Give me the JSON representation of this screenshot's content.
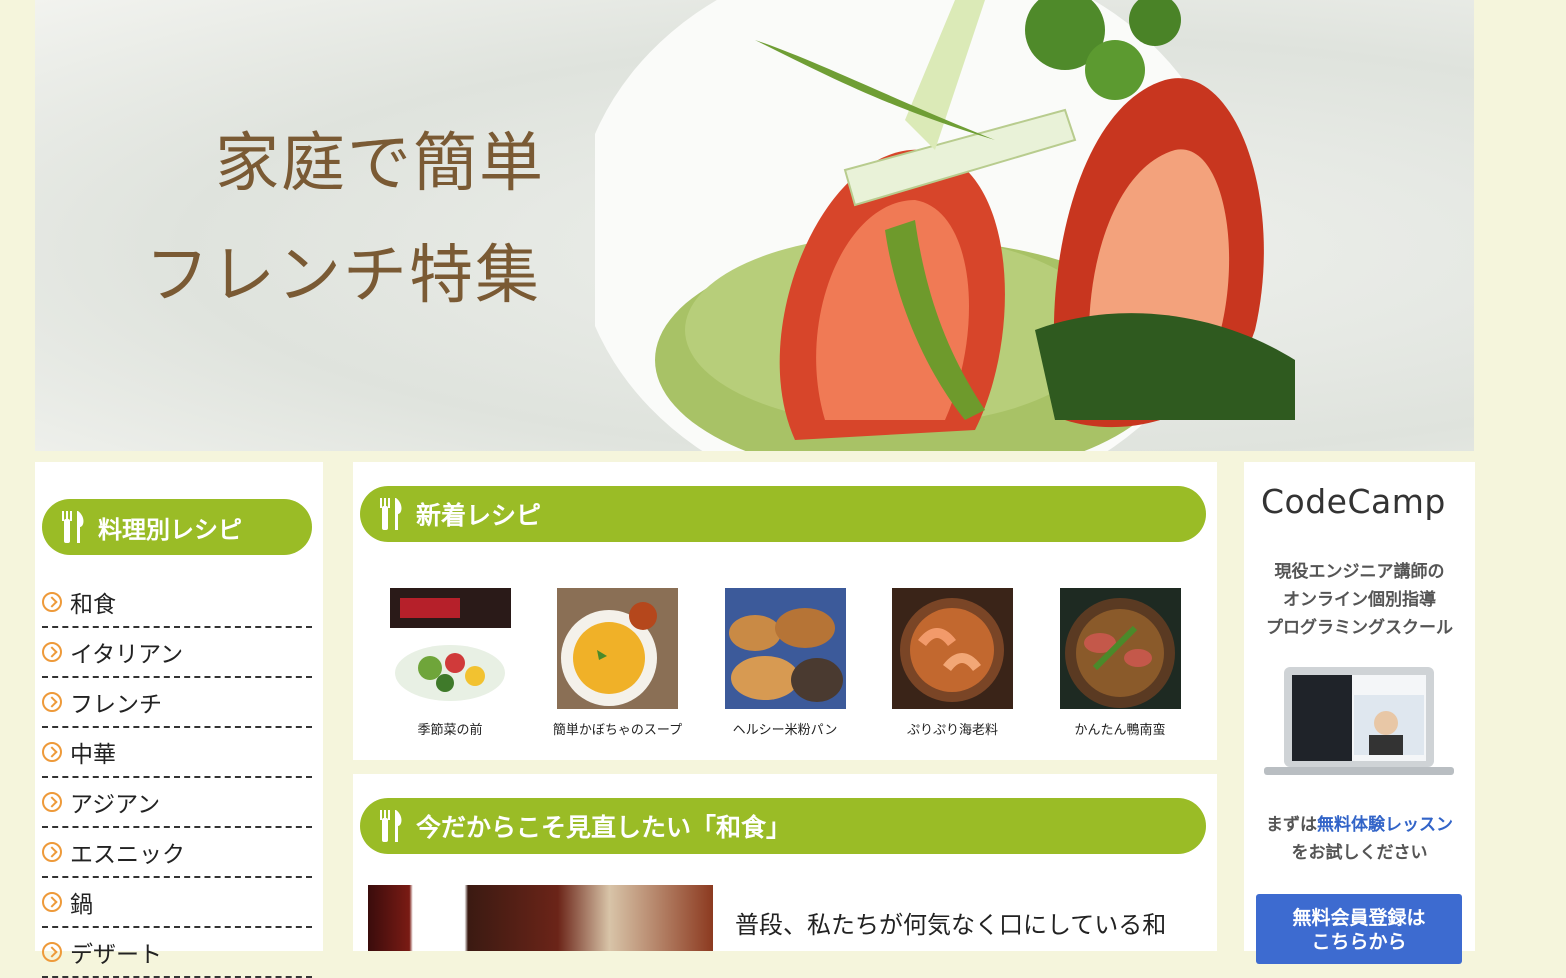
{
  "hero": {
    "line1": "家庭で簡単",
    "line2": "フレンチ特集"
  },
  "sidebar": {
    "heading": "料理別レシピ",
    "items": [
      {
        "label": "和食"
      },
      {
        "label": "イタリアン"
      },
      {
        "label": "フレンチ"
      },
      {
        "label": "中華"
      },
      {
        "label": "アジアン"
      },
      {
        "label": "エスニック"
      },
      {
        "label": "鍋"
      },
      {
        "label": "デザート"
      }
    ]
  },
  "new_recipes": {
    "heading": "新着レシピ",
    "items": [
      {
        "caption": "季節菜の前"
      },
      {
        "caption": "簡単かぼちゃのスープ"
      },
      {
        "caption": "ヘルシー米粉パン"
      },
      {
        "caption": "ぷりぷり海老料"
      },
      {
        "caption": "かんたん鴨南蛮"
      }
    ]
  },
  "feature": {
    "heading": "今だからこそ見直したい「和食」",
    "text": "普段、私たちが何気なく口にしている和"
  },
  "ad": {
    "logo_pre": "CodeC",
    "logo_mid": "a",
    "logo_post": "mp",
    "tag1": "現役エンジニア講師の",
    "tag2": "オンライン個別指導",
    "tag3": "プログラミングスクール",
    "cta_pre": "まずは",
    "cta_hl": "無料体験レッスン",
    "cta_post": "をお試しください",
    "btn1": "無料会員登録は",
    "btn2": "こちらから"
  },
  "colors": {
    "accent": "#9abc26",
    "page_bg": "#f5f5dc",
    "arrow": "#ee9a3a",
    "ad_blue": "#3d6bd0"
  }
}
